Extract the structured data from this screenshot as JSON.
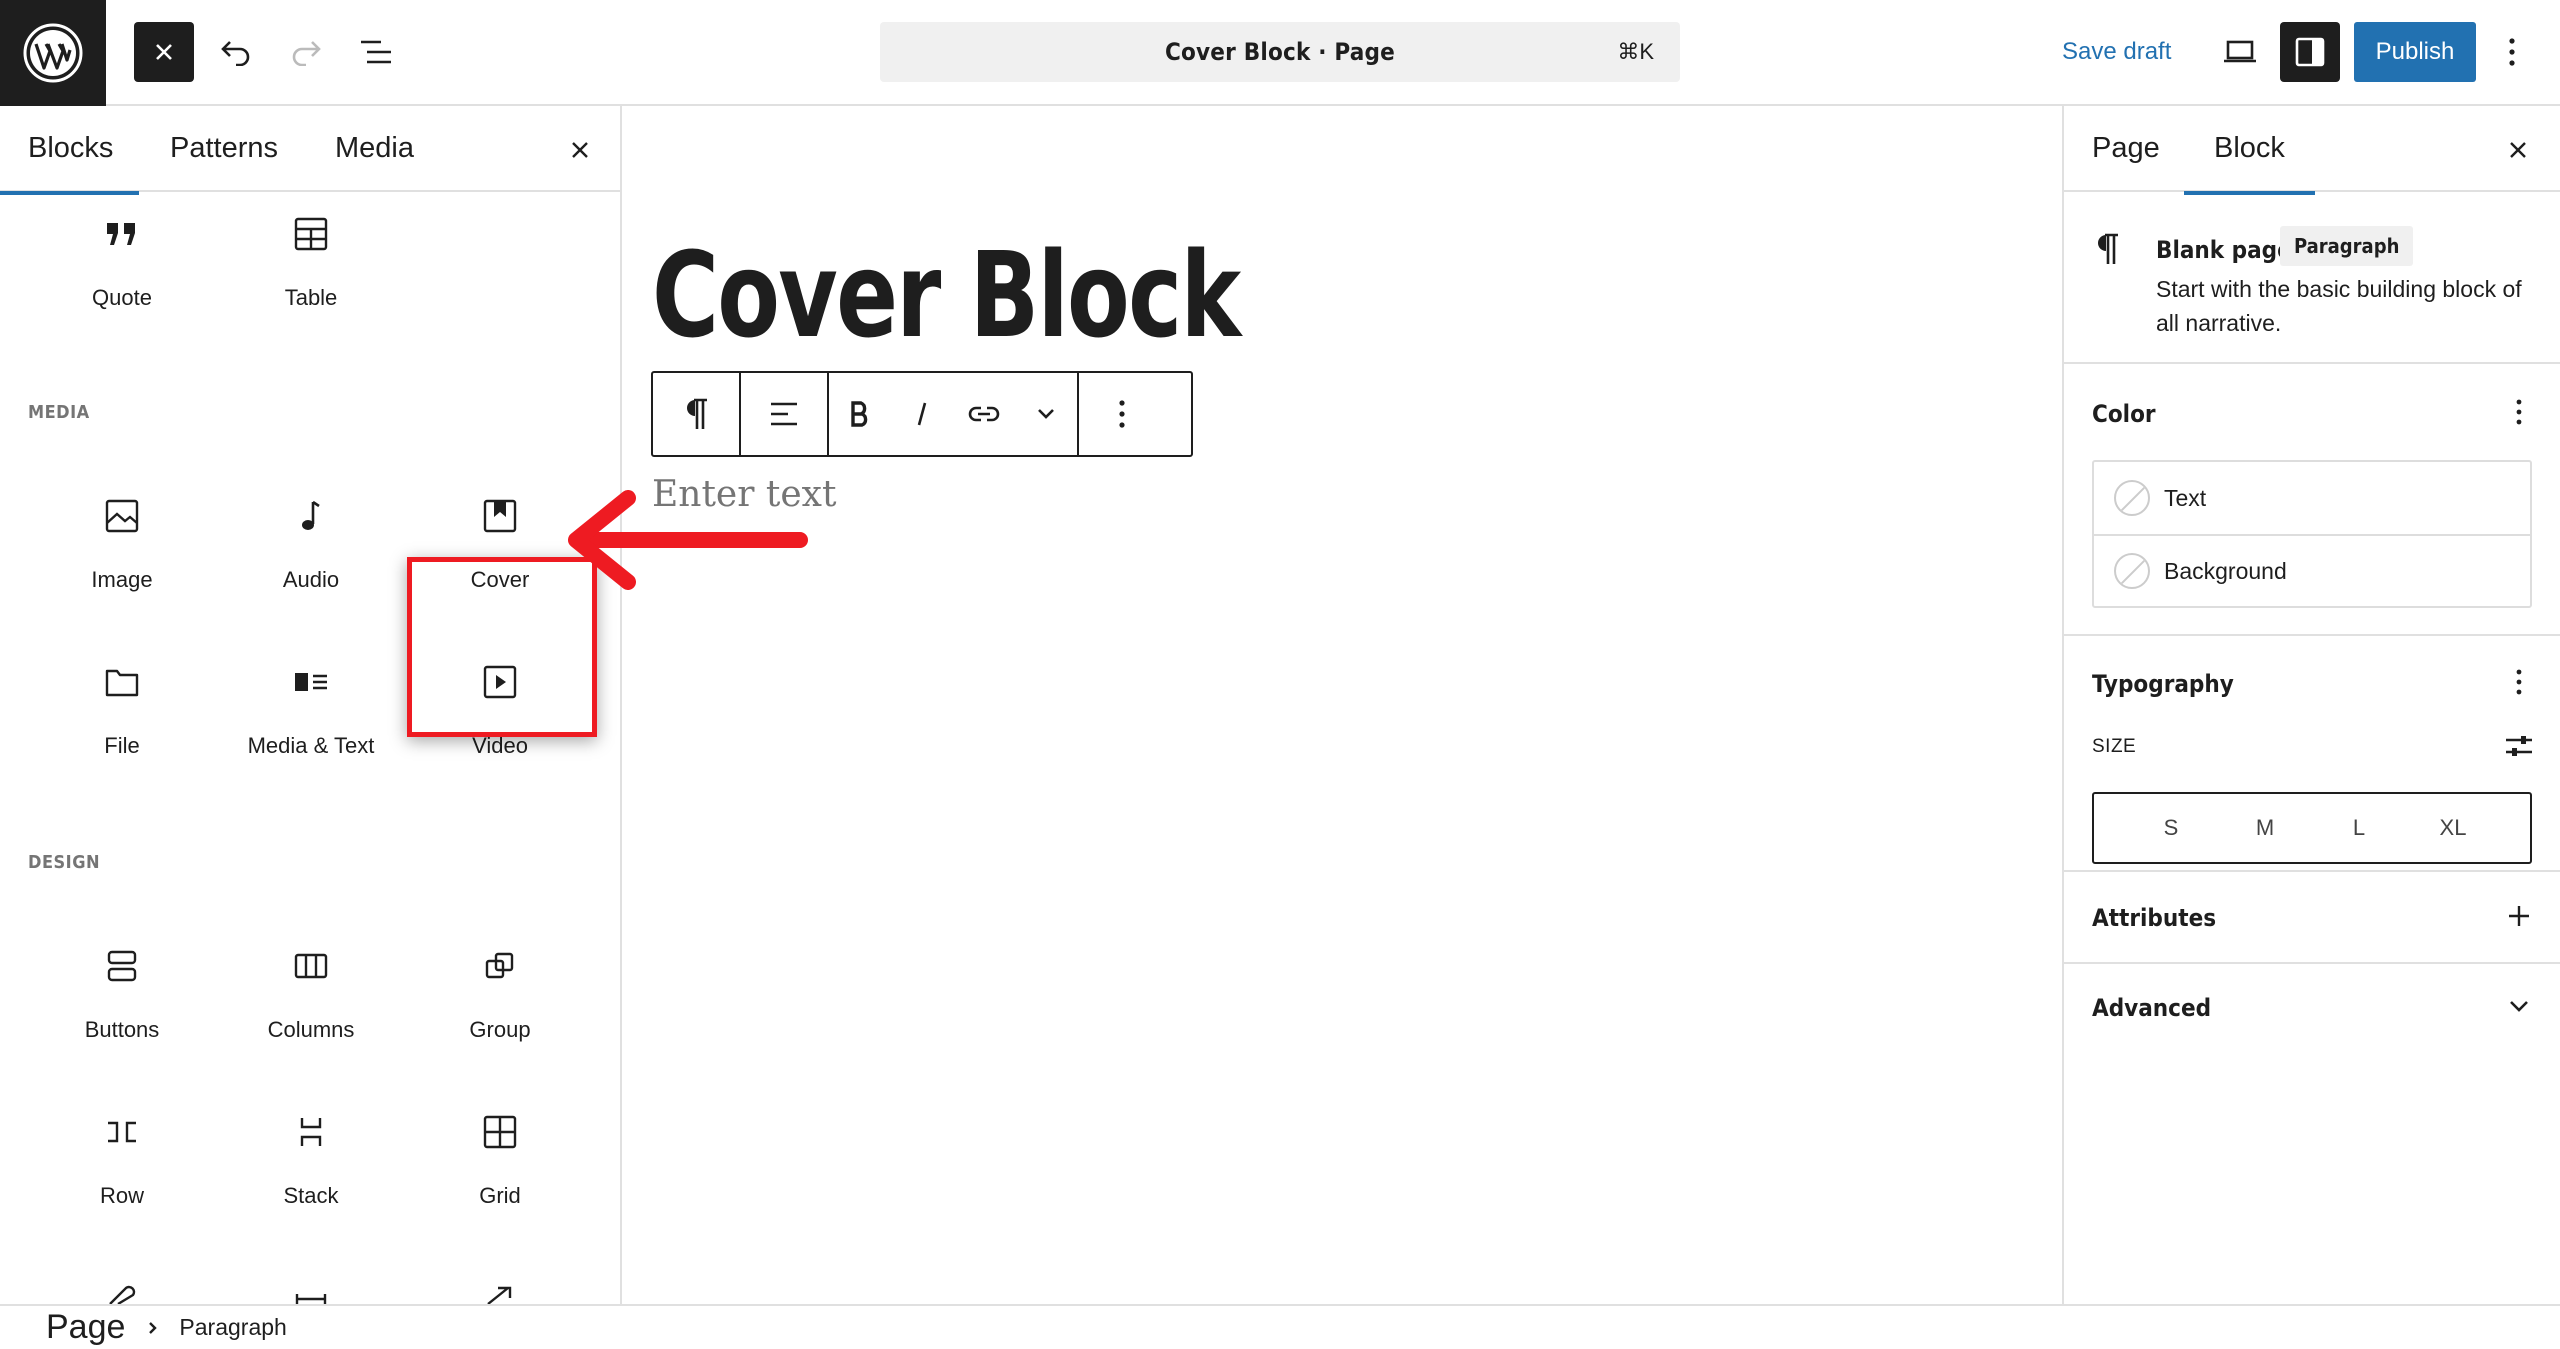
{
  "topbar": {
    "document_title": "Cover Block · Page",
    "command_shortcut": "⌘K",
    "save_draft_label": "Save draft",
    "publish_label": "Publish"
  },
  "inserter": {
    "tabs": [
      {
        "label": "Blocks",
        "active": true
      },
      {
        "label": "Patterns",
        "active": false
      },
      {
        "label": "Media",
        "active": false
      }
    ],
    "text_blocks": [
      {
        "label": "Quote",
        "icon": "quote-icon"
      },
      {
        "label": "Table",
        "icon": "table-icon"
      }
    ],
    "media_heading": "MEDIA",
    "media_blocks": [
      {
        "label": "Image",
        "icon": "image-icon"
      },
      {
        "label": "Audio",
        "icon": "audio-icon"
      },
      {
        "label": "Cover",
        "icon": "cover-icon"
      },
      {
        "label": "File",
        "icon": "file-icon"
      },
      {
        "label": "Media & Text",
        "icon": "media-text-icon"
      },
      {
        "label": "Video",
        "icon": "video-icon"
      }
    ],
    "design_heading": "DESIGN",
    "design_blocks": [
      {
        "label": "Buttons",
        "icon": "buttons-icon"
      },
      {
        "label": "Columns",
        "icon": "columns-icon"
      },
      {
        "label": "Group",
        "icon": "group-icon"
      },
      {
        "label": "Row",
        "icon": "row-icon"
      },
      {
        "label": "Stack",
        "icon": "stack-icon"
      },
      {
        "label": "Grid",
        "icon": "grid-icon"
      }
    ],
    "highlight_color": "#ee1b22"
  },
  "canvas": {
    "title": "Cover Block",
    "placeholder": "Enter text"
  },
  "sidebar": {
    "tabs": [
      {
        "label": "Page",
        "active": false
      },
      {
        "label": "Block",
        "active": true
      }
    ],
    "block_card": {
      "title": "Blank page",
      "badge": "Paragraph",
      "description": "Start with the basic building block of all narrative."
    },
    "color": {
      "title": "Color",
      "items": [
        "Text",
        "Background"
      ]
    },
    "typography": {
      "title": "Typography",
      "size_label": "SIZE",
      "sizes": [
        "S",
        "M",
        "L",
        "XL"
      ]
    },
    "attributes_title": "Attributes",
    "advanced_title": "Advanced"
  },
  "breadcrumb": {
    "root": "Page",
    "current": "Paragraph"
  },
  "colors": {
    "accent": "#2271b1",
    "dark": "#1e1e1e"
  }
}
